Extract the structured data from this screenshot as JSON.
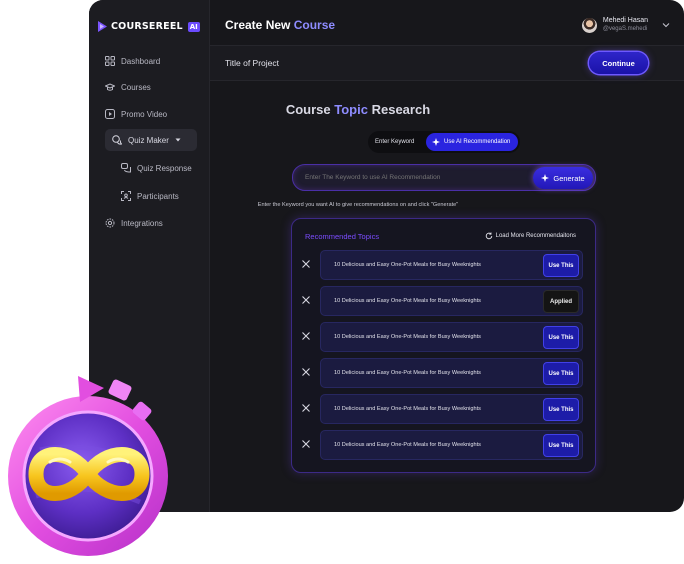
{
  "brand": {
    "name": "COURSEREEL",
    "badge": "AI"
  },
  "sidebar": {
    "items": [
      {
        "label": "Dashboard",
        "icon": "grid-icon"
      },
      {
        "label": "Courses",
        "icon": "graduation-cap-icon"
      },
      {
        "label": "Promo Video",
        "icon": "play-square-icon"
      },
      {
        "label": "Quiz Maker",
        "icon": "quiz-icon",
        "active": true,
        "expanded": true
      },
      {
        "label": "Quiz Response",
        "icon": "chat-icon",
        "sub": true
      },
      {
        "label": "Participants",
        "icon": "scan-user-icon",
        "sub": true
      },
      {
        "label": "Integrations",
        "icon": "gear-icon"
      }
    ]
  },
  "header": {
    "title_main": "Create New",
    "title_accent": "Course",
    "user": {
      "name": "Mehedi Hasan",
      "handle": "@vegaS.mehedi"
    }
  },
  "subheader": {
    "title": "Title of Project",
    "continue_label": "Continue"
  },
  "research": {
    "title_main": "Course",
    "title_accent": "Topic",
    "title_end": "Research",
    "toggle": {
      "left_label": "Enter Keyword",
      "right_label": "Use AI Recommendation",
      "selected": "right"
    },
    "search": {
      "placeholder": "Enter The Keyword to use AI Recommendation",
      "value": ""
    },
    "generate_label": "Generate",
    "hint": "Enter the Keyword you want AI to give recommendations on and click \"Generate\""
  },
  "recommendations": {
    "title": "Recommended Topics",
    "load_more_label": "Load More Recommendaitons",
    "rows": [
      {
        "text": "10 Delicious and Easy One-Pot Meals for Busy Weeknights",
        "button": "Use This",
        "state": "default"
      },
      {
        "text": "10 Delicious and Easy One-Pot Meals for Busy Weeknights",
        "button": "Applied",
        "state": "applied"
      },
      {
        "text": "10 Delicious and Easy One-Pot Meals for Busy Weeknights",
        "button": "Use This",
        "state": "default"
      },
      {
        "text": "10 Delicious and Easy One-Pot Meals for Busy Weeknights",
        "button": "Use This",
        "state": "default"
      },
      {
        "text": "10 Delicious and Easy One-Pot Meals for Busy Weeknights",
        "button": "Use This",
        "state": "default"
      },
      {
        "text": "10 Delicious and Easy One-Pot Meals for Busy Weeknights",
        "button": "Use This",
        "state": "default"
      }
    ]
  },
  "colors": {
    "accent": "#8e8cff",
    "primary_button": "#2a24e0",
    "panel_border": "#3c2a86",
    "background": "#17171b"
  }
}
